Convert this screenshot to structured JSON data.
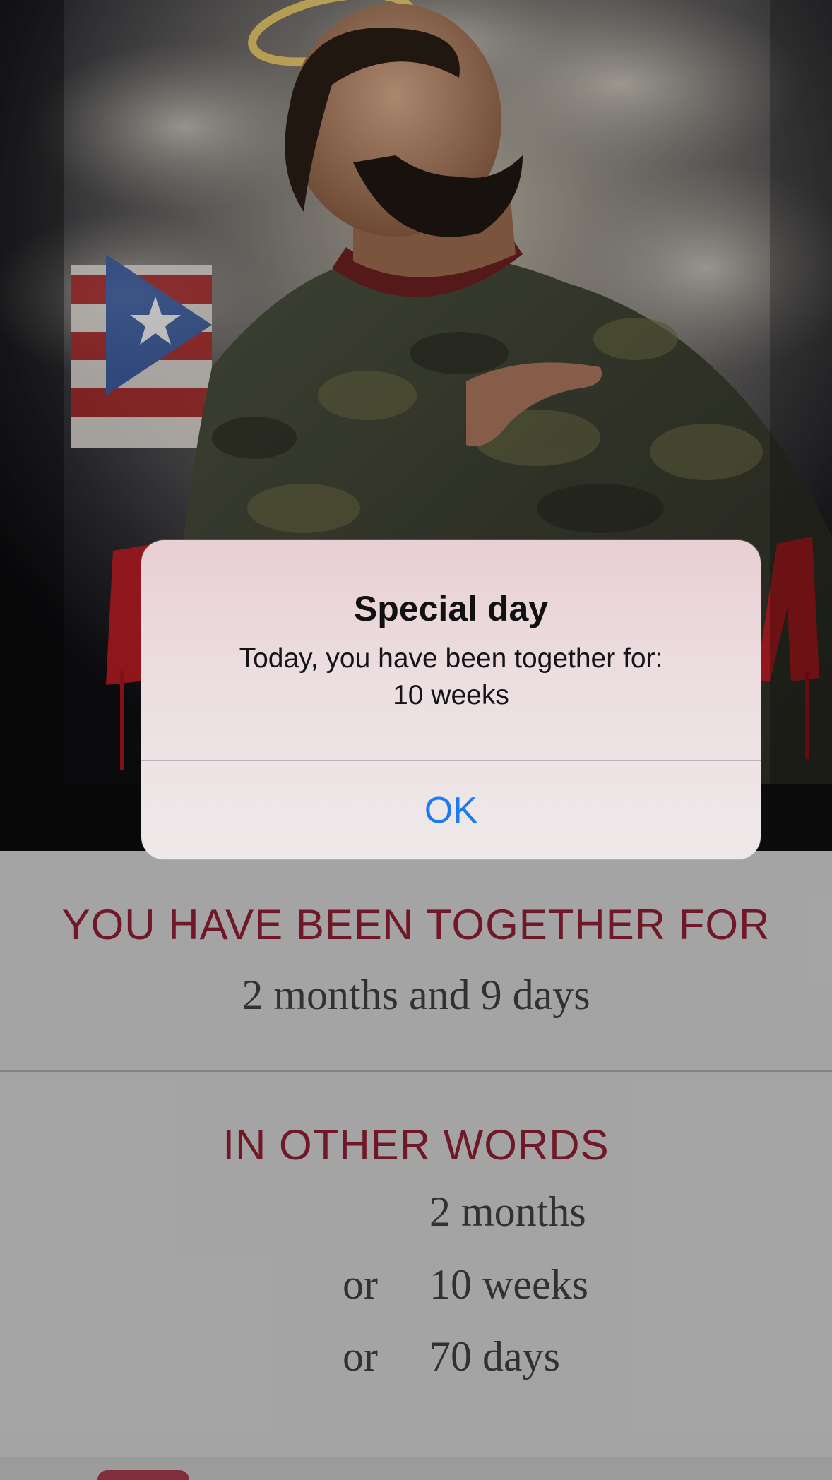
{
  "alert": {
    "title": "Special day",
    "message_line1": "Today, you have been together for:",
    "message_line2": "10 weeks",
    "ok_label": "OK"
  },
  "together": {
    "heading": "YOU HAVE BEEN TOGETHER FOR",
    "value": "2 months and 9 days"
  },
  "other_words": {
    "heading": "IN OTHER WORDS",
    "rows": [
      {
        "prefix": "",
        "value": "2 months"
      },
      {
        "prefix": "or",
        "value": "10 weeks"
      },
      {
        "prefix": "or",
        "value": "70 days"
      }
    ]
  },
  "colors": {
    "accent": "#8c1f33",
    "alert_button": "#1a7cf0",
    "background": "#cecece"
  }
}
